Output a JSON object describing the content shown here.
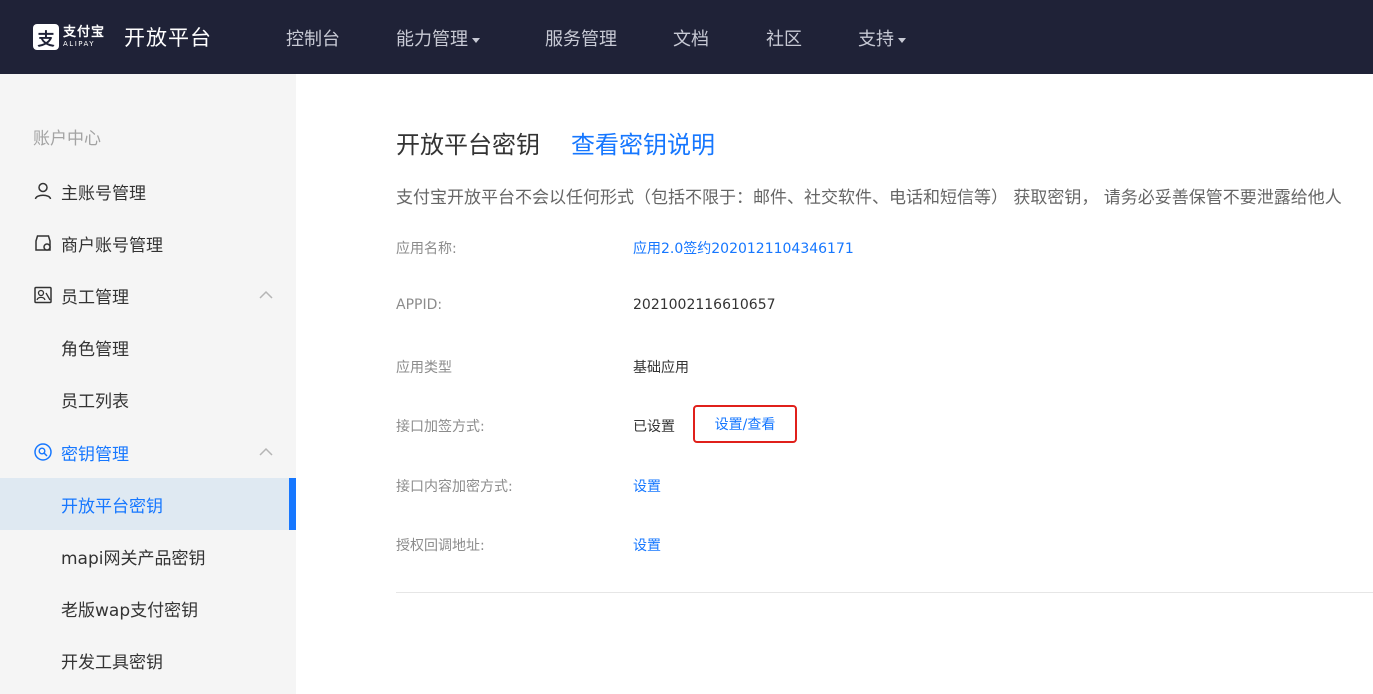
{
  "header": {
    "logo": {
      "icon": "alipay-logo-icon",
      "cn": "支付宝",
      "en": "ALIPAY"
    },
    "title": "开放平台",
    "nav": [
      {
        "label": "控制台"
      },
      {
        "label": "能力管理",
        "dropdown": true
      },
      {
        "label": "服务管理"
      },
      {
        "label": "文档"
      },
      {
        "label": "社区"
      },
      {
        "label": "支持",
        "dropdown": true
      }
    ]
  },
  "sidebar": {
    "group_title": "账户中心",
    "items": [
      {
        "label": "主账号管理",
        "icon": "user-icon"
      },
      {
        "label": "商户账号管理",
        "icon": "merchant-account-icon"
      },
      {
        "label": "员工管理",
        "icon": "staff-icon",
        "expanded": true
      },
      {
        "label": "角色管理"
      },
      {
        "label": "员工列表"
      },
      {
        "label": "密钥管理",
        "icon": "key-search-icon",
        "expanded": true
      },
      {
        "label": "开放平台密钥",
        "active": true
      },
      {
        "label": "mapi网关产品密钥"
      },
      {
        "label": "老版wap支付密钥"
      },
      {
        "label": "开发工具密钥"
      }
    ]
  },
  "main": {
    "title": "开放平台密钥",
    "help_link": "查看密钥说明",
    "notice": "支付宝开放平台不会以任何形式（包括不限于：邮件、社交软件、电话和短信等） 获取密钥， 请务必妥善保管不要泄露给他人",
    "rows": [
      {
        "label": "应用名称:",
        "value": "应用2.0签约2020121104346171"
      },
      {
        "label": "APPID:",
        "value": "2021002116610657"
      },
      {
        "label": "应用类型",
        "value": "基础应用"
      },
      {
        "label": "接口加签方式:",
        "value": "已设置",
        "action": "设置/查看"
      },
      {
        "label": "接口内容加密方式:",
        "value": "设置"
      },
      {
        "label": "授权回调地址:",
        "value": "设置"
      }
    ]
  },
  "colors": {
    "header_bg": "#1f2237",
    "accent": "#1677ff",
    "sidebar_bg": "#f5f5f5",
    "active_item_bg": "#dfe9f2",
    "highlight_border": "#e0201b"
  }
}
